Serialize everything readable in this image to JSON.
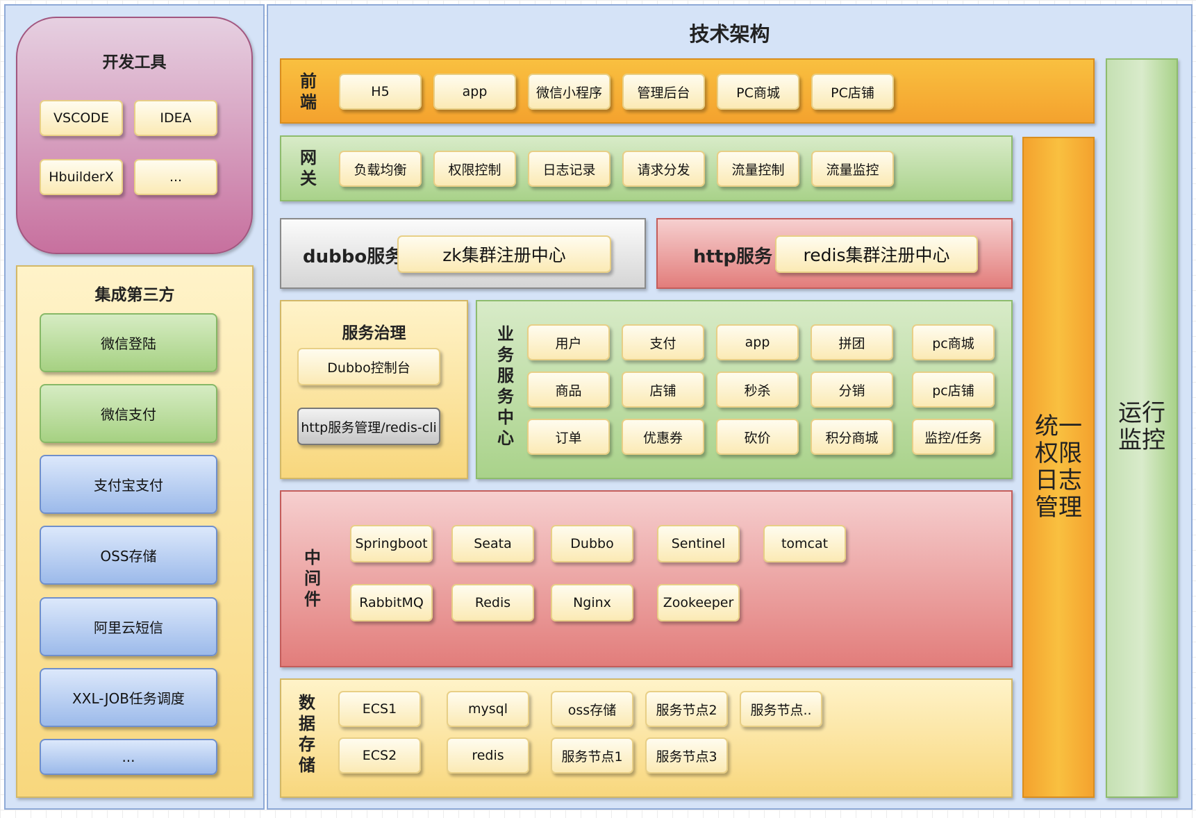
{
  "main_title": "技术架构",
  "devtools": {
    "title": "开发工具",
    "items": [
      "VSCODE",
      "IDEA",
      "HbuilderX",
      "..."
    ]
  },
  "thirdparty": {
    "title": "集成第三方",
    "items": [
      "微信登陆",
      "微信支付",
      "支付宝支付",
      "OSS存储",
      "阿里云短信",
      "XXL-JOB任务调度",
      "..."
    ]
  },
  "frontend": {
    "label": "前\n端",
    "items": [
      "H5",
      "app",
      "微信小程序",
      "管理后台",
      "PC商城",
      "PC店铺"
    ]
  },
  "gateway": {
    "label": "网\n关",
    "items": [
      "负载均衡",
      "权限控制",
      "日志记录",
      "请求分发",
      "流量控制",
      "流量监控"
    ]
  },
  "dubbo": {
    "label": "dubbo服务",
    "registry": "zk集群注册中心"
  },
  "http": {
    "label": "http服务",
    "registry": "redis集群注册中心"
  },
  "governance": {
    "title": "服务治理",
    "items": [
      "Dubbo控制台",
      "http服务管理/redis-cli"
    ]
  },
  "business": {
    "label": "业\n务\n服\n务\n中\n心",
    "rows": [
      [
        "用户",
        "支付",
        "app",
        "拼团",
        "pc商城"
      ],
      [
        "商品",
        "店铺",
        "秒杀",
        "分销",
        "pc店铺"
      ],
      [
        "订单",
        "优惠券",
        "砍价",
        "积分商城",
        "监控/任务"
      ]
    ]
  },
  "middleware": {
    "label": "中\n间\n件",
    "row1": [
      "Springboot",
      "Seata",
      "Dubbo",
      "Sentinel",
      "tomcat"
    ],
    "row2": [
      "RabbitMQ",
      "Redis",
      "Nginx",
      "Zookeeper"
    ]
  },
  "storage": {
    "label": "数\n据\n存\n储",
    "row1": [
      "ECS1",
      "mysql",
      "oss存储",
      "服务节点2",
      "服务节点.."
    ],
    "row2": [
      "ECS2",
      "redis",
      "服务节点1",
      "服务节点3"
    ]
  },
  "unified": {
    "label": "统一\n权限\n日志\n管理"
  },
  "monitor": {
    "label": "运行\n监控"
  }
}
